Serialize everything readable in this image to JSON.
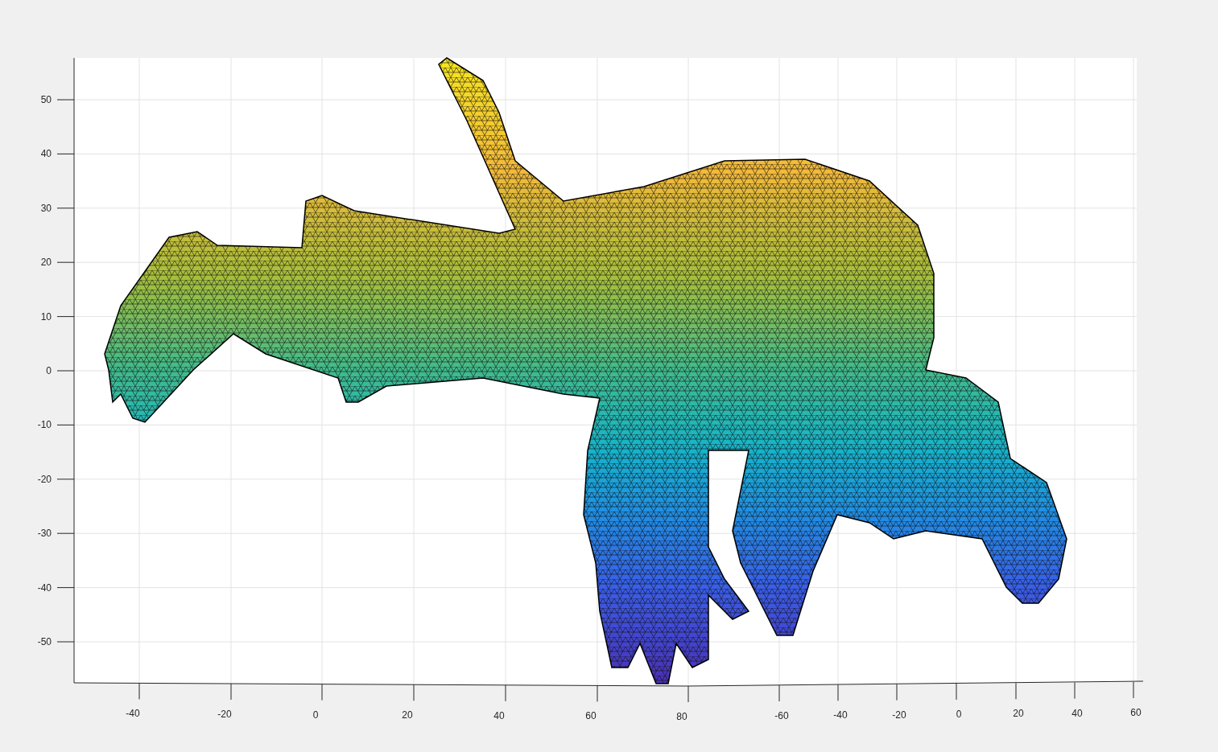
{
  "plot": {
    "y_ticks": [
      "50",
      "40",
      "30",
      "20",
      "10",
      "0",
      "-10",
      "-20",
      "-30",
      "-40",
      "-50"
    ],
    "x_ticks": [
      "-40",
      "-20",
      "0",
      "20",
      "40",
      "60",
      "80"
    ],
    "x_ticks_2": [
      "-60",
      "-40",
      "-20",
      "0",
      "20",
      "40",
      "60"
    ]
  }
}
